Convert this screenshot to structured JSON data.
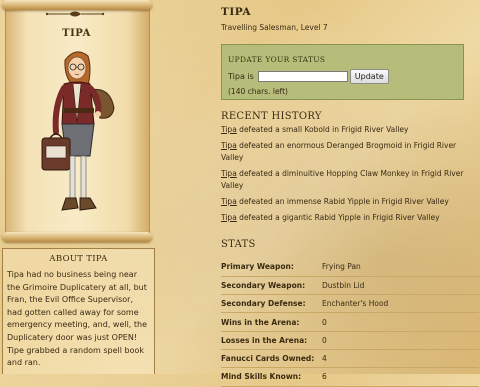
{
  "hero": {
    "name": "TIPA"
  },
  "about": {
    "title": "ABOUT TIPA",
    "text": "Tipa had no business being near the Grimoire Duplicatery at all, but Fran, the Evil Office Supervisor, had gotten called away for some emergency meeting, and, well, the Duplicatery door was just OPEN! Tipe grabbed a random spell book and ran."
  },
  "profile": {
    "name": "TIPA",
    "subtitle": "Travelling Salesman, Level 7"
  },
  "status": {
    "title": "UPDATE YOUR STATUS",
    "label": "Tipa is",
    "input_value": "",
    "button": "Update",
    "chars_left": "(140 chars. left)"
  },
  "history": {
    "title": "RECENT HISTORY",
    "items": [
      {
        "who": "Tipa",
        "text": " defeated a small Kobold in Frigid River Valley"
      },
      {
        "who": "Tipa",
        "text": " defeated an enormous Deranged Brogmoid in Frigid River Valley"
      },
      {
        "who": "Tipa",
        "text": " defeated a diminuitive Hopping Claw Monkey in Frigid River Valley"
      },
      {
        "who": "Tipa",
        "text": " defeated an immense Rabid Yipple in Frigid River Valley"
      },
      {
        "who": "Tipa",
        "text": " defeated a gigantic Rabid Yipple in Frigid River Valley"
      }
    ]
  },
  "stats": {
    "title": "STATS",
    "rows": [
      {
        "label": "Primary Weapon:",
        "value": "Frying Pan"
      },
      {
        "label": "Secondary Weapon:",
        "value": "Dustbin Lid"
      },
      {
        "label": "Secondary Defense:",
        "value": "Enchanter's Hood"
      },
      {
        "label": "Wins in the Arena:",
        "value": "0"
      },
      {
        "label": "Losses in the Arena:",
        "value": "0"
      },
      {
        "label": "Fanucci Cards Owned:",
        "value": "4"
      },
      {
        "label": "Mind Skills Known:",
        "value": "6"
      }
    ]
  },
  "colors": {
    "parchment": "#ecd39a",
    "status_box": "#b6bd7a",
    "text": "#3a2a12"
  }
}
